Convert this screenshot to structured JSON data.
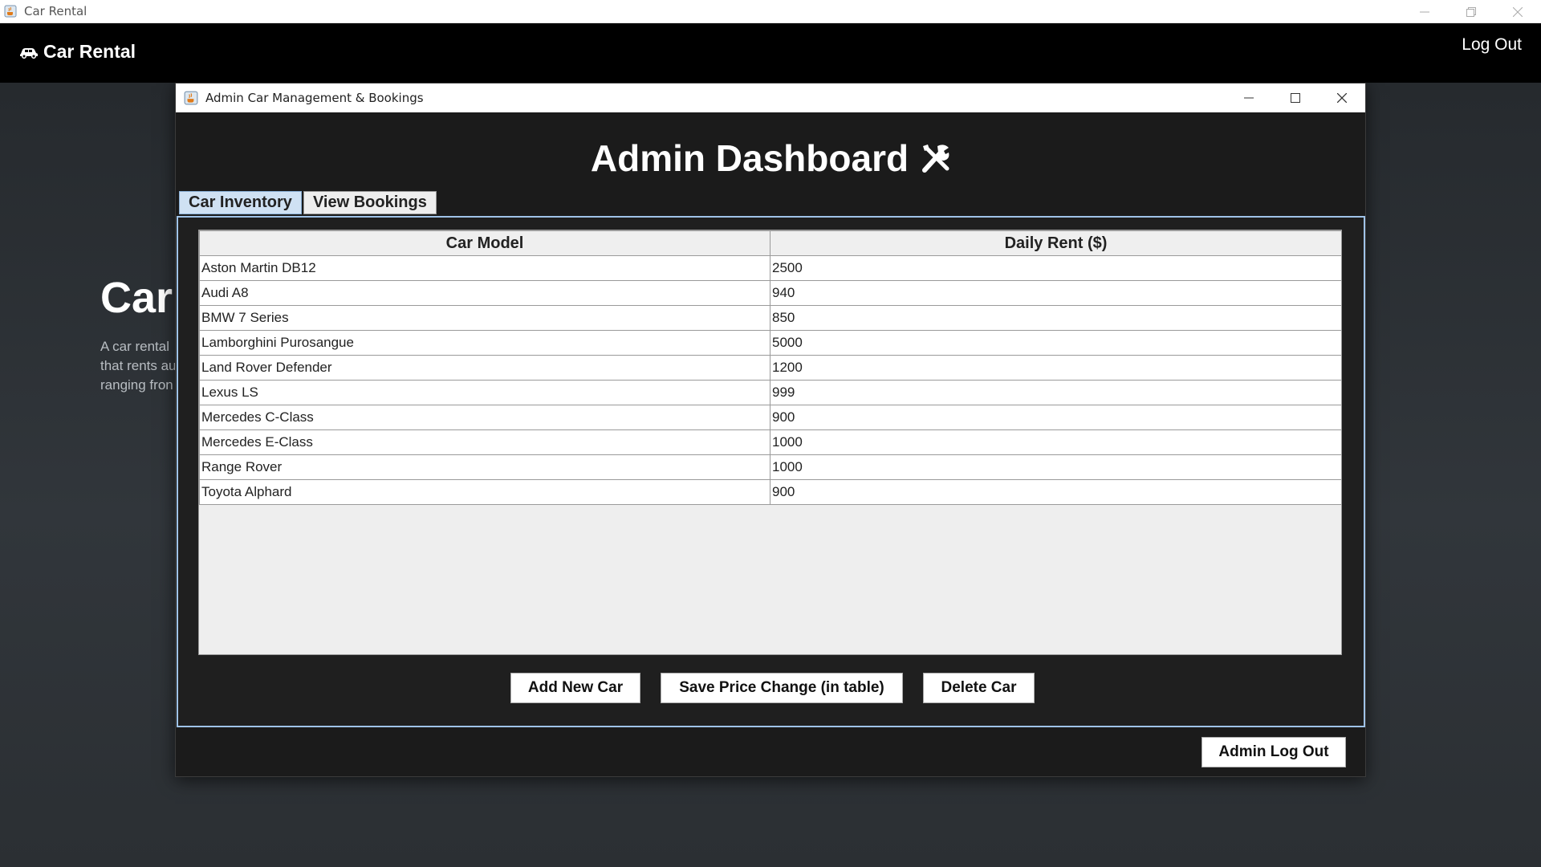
{
  "os_window": {
    "title": "Car Rental",
    "icon": "java-cup-icon"
  },
  "header": {
    "brand_label": "Car Rental",
    "brand_icon": "car-icon",
    "logout_label": "Log Out"
  },
  "background_page": {
    "hero_title": "Car",
    "hero_lines": [
      "A car rental",
      "that rents au",
      "ranging fron"
    ]
  },
  "dialog": {
    "title": "Admin Car Management & Bookings",
    "heading": "Admin Dashboard",
    "heading_icon": "tools-icon",
    "tabs": [
      {
        "label": "Car Inventory",
        "active": true
      },
      {
        "label": "View Bookings",
        "active": false
      }
    ],
    "table": {
      "columns": [
        "Car Model",
        "Daily Rent ($)"
      ],
      "rows": [
        [
          "Aston Martin DB12",
          "2500"
        ],
        [
          "Audi A8",
          "940"
        ],
        [
          "BMW 7 Series",
          "850"
        ],
        [
          "Lamborghini Purosangue",
          "5000"
        ],
        [
          "Land Rover Defender",
          "1200"
        ],
        [
          "Lexus LS",
          "999"
        ],
        [
          "Mercedes C-Class",
          "900"
        ],
        [
          "Mercedes E-Class",
          "1000"
        ],
        [
          "Range Rover",
          "1000"
        ],
        [
          "Toyota Alphard",
          "900"
        ]
      ]
    },
    "buttons": {
      "add": "Add New Car",
      "save": "Save Price Change (in table)",
      "delete": "Delete Car"
    },
    "admin_logout": "Admin Log Out"
  },
  "colors": {
    "tab_active": "#cfe1f3",
    "panel_border": "#9fc3e8",
    "dialog_bg": "#1b1b1b",
    "header_bg": "#000000"
  }
}
